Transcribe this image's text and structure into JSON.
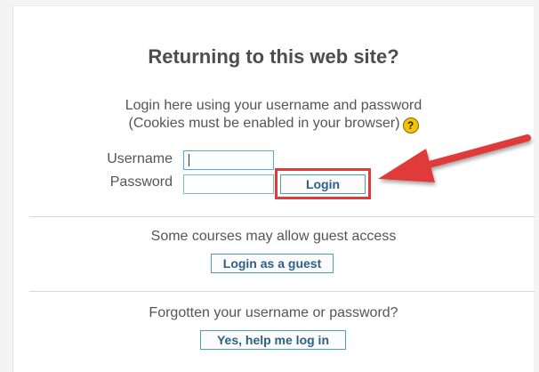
{
  "login_box": {
    "title": "Returning to this web site?",
    "instructions_line1": "Login here using your username and password",
    "instructions_line2": "(Cookies must be enabled in your browser)",
    "help_icon_glyph": "?",
    "username_label": "Username",
    "password_label": "Password",
    "username_value": "",
    "password_value": "",
    "login_button": "Login"
  },
  "guest": {
    "text": "Some courses may allow guest access",
    "button": "Login as a guest"
  },
  "forgot": {
    "text": "Forgotten your username or password?",
    "button": "Yes, help me log in"
  },
  "annotation": {
    "highlight_color": "#e03a3a",
    "arrow_color": "#e03a3a"
  },
  "icons": {
    "help": "help-icon",
    "arrow": "red-arrow-annotation"
  }
}
